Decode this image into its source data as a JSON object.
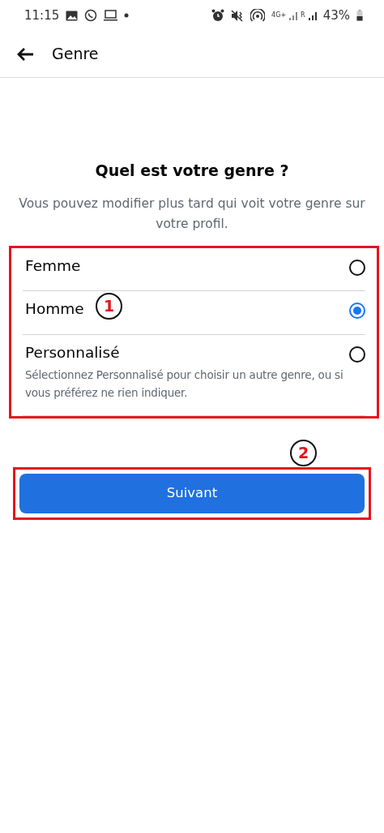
{
  "status_bar": {
    "time": "11:15",
    "network": "4G+",
    "roaming": "R",
    "battery": "43%"
  },
  "header": {
    "title": "Genre"
  },
  "heading": "Quel est votre genre ?",
  "subtitle": "Vous pouvez modifier plus tard qui voit votre genre sur votre profil.",
  "options": [
    {
      "label": "Femme",
      "selected": false
    },
    {
      "label": "Homme",
      "selected": true
    },
    {
      "label": "Personnalisé",
      "selected": false,
      "description": "Sélectionnez Personnalisé pour choisir un autre genre, ou si vous préférez ne rien indiquer."
    }
  ],
  "button": "Suivant",
  "options_annotation": {
    "label": "1"
  },
  "button_annotation": {
    "label": "2"
  }
}
